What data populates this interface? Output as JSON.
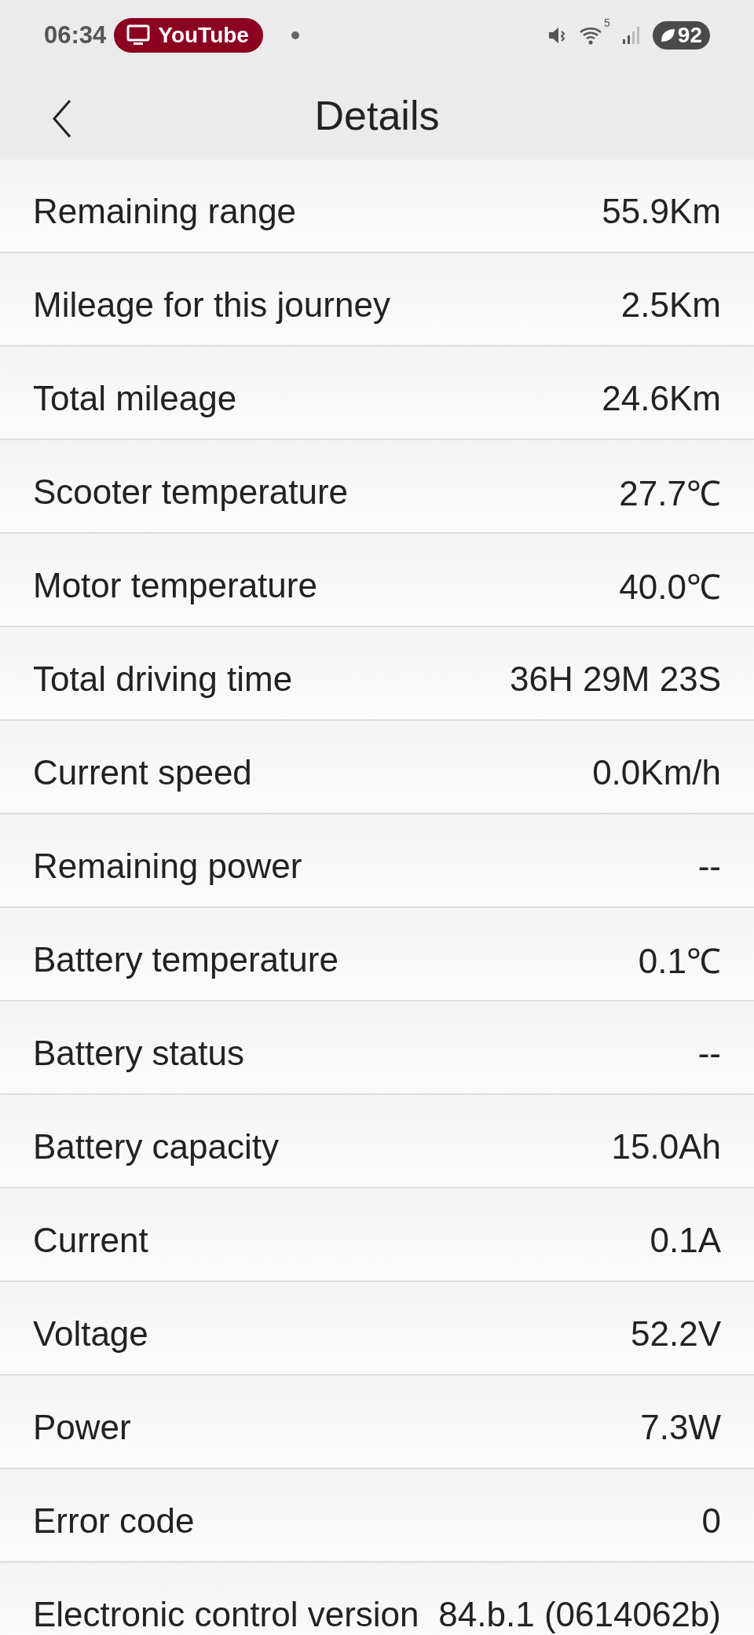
{
  "status_bar": {
    "time": "06:34",
    "app_chip": "YouTube",
    "wifi_band": "5",
    "battery": "92"
  },
  "header": {
    "title": "Details"
  },
  "rows": [
    {
      "label": "Remaining range",
      "value": "55.9Km"
    },
    {
      "label": "Mileage for this journey",
      "value": "2.5Km"
    },
    {
      "label": "Total mileage",
      "value": "24.6Km"
    },
    {
      "label": "Scooter temperature",
      "value": "27.7℃"
    },
    {
      "label": "Motor temperature",
      "value": "40.0℃"
    },
    {
      "label": "Total driving time",
      "value": "36H 29M 23S"
    },
    {
      "label": "Current speed",
      "value": "0.0Km/h"
    },
    {
      "label": "Remaining power",
      "value": "--"
    },
    {
      "label": "Battery temperature",
      "value": "0.1℃"
    },
    {
      "label": "Battery status",
      "value": "--"
    },
    {
      "label": "Battery capacity",
      "value": "15.0Ah"
    },
    {
      "label": "Current",
      "value": "0.1A"
    },
    {
      "label": "Voltage",
      "value": "52.2V"
    },
    {
      "label": "Power",
      "value": "7.3W"
    },
    {
      "label": "Error code",
      "value": "0"
    },
    {
      "label": "Electronic control version",
      "value": "84.b.1 (0614062b)"
    }
  ]
}
